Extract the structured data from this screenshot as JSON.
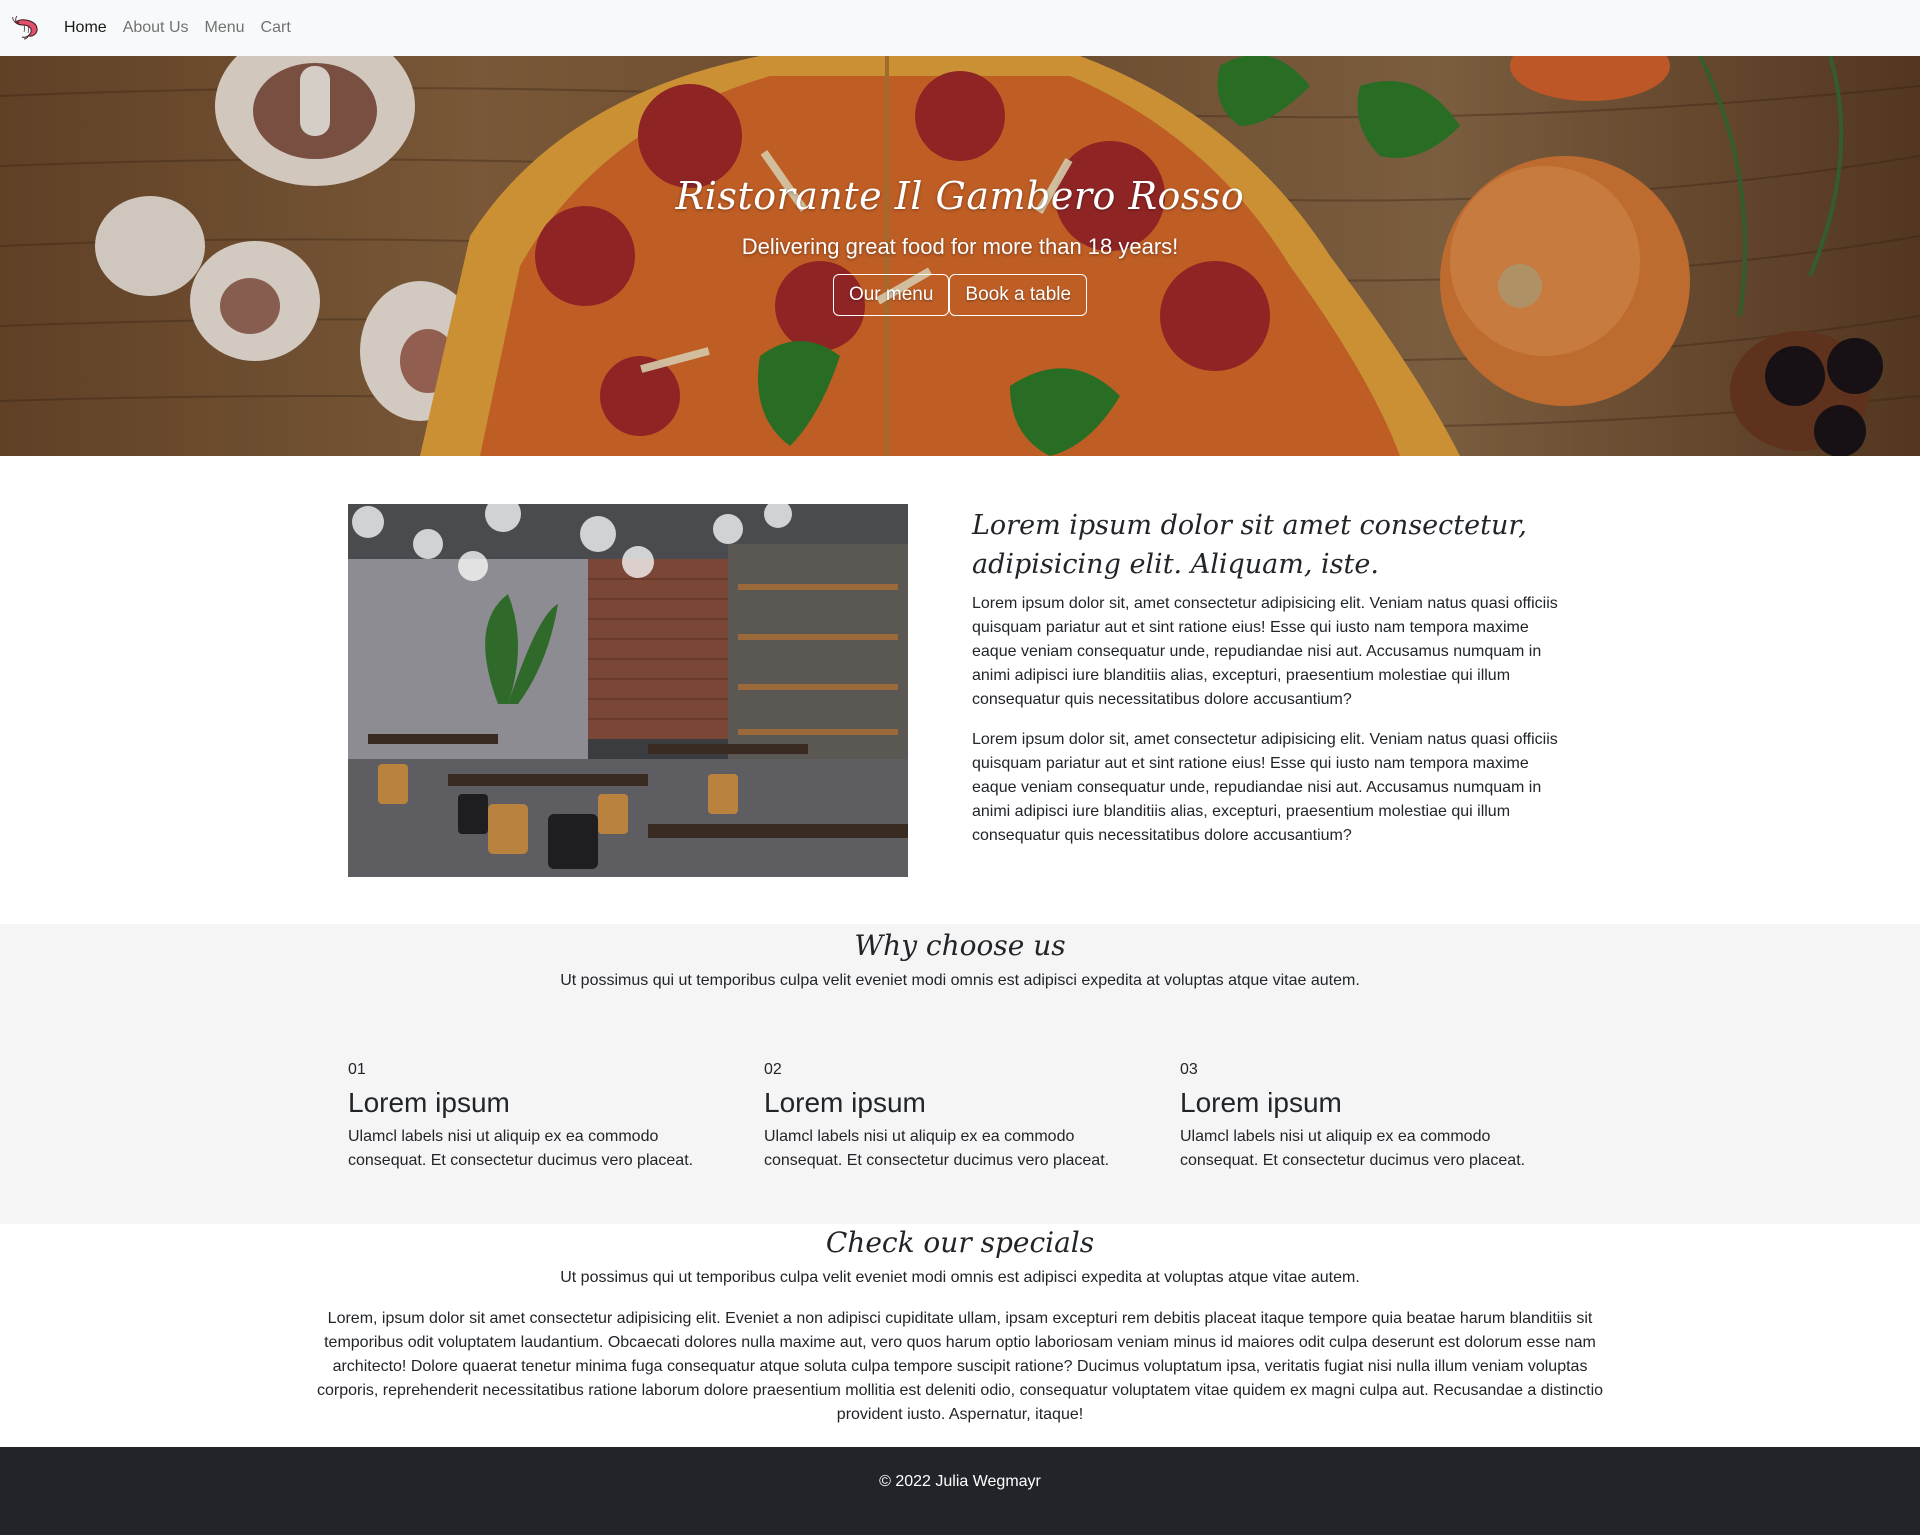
{
  "nav": {
    "brand_icon": "shrimp-logo-icon",
    "links": [
      {
        "label": "Home",
        "active": true
      },
      {
        "label": "About Us",
        "active": false
      },
      {
        "label": "Menu",
        "active": false
      },
      {
        "label": "Cart",
        "active": false
      }
    ]
  },
  "hero": {
    "title": "Ristorante Il Gambero Rosso",
    "subtitle": "Delivering great food for more than 18 years!",
    "buttons": {
      "menu": "Our menu",
      "book": "Book a table"
    }
  },
  "about": {
    "heading": "Lorem ipsum dolor sit amet consectetur, adipisicing elit. Aliquam, iste.",
    "paragraphs": [
      "Lorem ipsum dolor sit, amet consectetur adipisicing elit. Veniam natus quasi officiis quisquam pariatur aut et sint ratione eius! Esse qui iusto nam tempora maxime eaque veniam consequatur unde, repudiandae nisi aut. Accusamus numquam in animi adipisci iure blanditiis alias, excepturi, praesentium molestiae qui illum consequatur quis necessitatibus dolore accusantium?",
      "Lorem ipsum dolor sit, amet consectetur adipisicing elit. Veniam natus quasi officiis quisquam pariatur aut et sint ratione eius! Esse qui iusto nam tempora maxime eaque veniam consequatur unde, repudiandae nisi aut. Accusamus numquam in animi adipisci iure blanditiis alias, excepturi, praesentium molestiae qui illum consequatur quis necessitatibus dolore accusantium?"
    ]
  },
  "why": {
    "title": "Why choose us",
    "subtitle": "Ut possimus qui ut temporibus culpa velit eveniet modi omnis est adipisci expedita at voluptas atque vitae autem.",
    "features": [
      {
        "number": "01",
        "title": "Lorem ipsum",
        "desc": "Ulamcl labels nisi ut aliquip ex ea commodo consequat. Et consectetur ducimus vero placeat."
      },
      {
        "number": "02",
        "title": "Lorem ipsum",
        "desc": "Ulamcl labels nisi ut aliquip ex ea commodo consequat. Et consectetur ducimus vero placeat."
      },
      {
        "number": "03",
        "title": "Lorem ipsum",
        "desc": "Ulamcl labels nisi ut aliquip ex ea commodo consequat. Et consectetur ducimus vero placeat."
      }
    ]
  },
  "specials": {
    "title": "Check our specials",
    "subtitle": "Ut possimus qui ut temporibus culpa velit eveniet modi omnis est adipisci expedita at voluptas atque vitae autem.",
    "text": "Lorem, ipsum dolor sit amet consectetur adipisicing elit. Eveniet a non adipisci cupiditate ullam, ipsam excepturi rem debitis placeat itaque tempore quia beatae harum blanditiis sit temporibus odit voluptatem laudantium. Obcaecati dolores nulla maxime aut, vero quos harum optio laboriosam veniam minus id maiores odit culpa deserunt est dolorum esse nam architecto! Dolore quaerat tenetur minima fuga consequatur atque soluta culpa tempore suscipit ratione? Ducimus voluptatum ipsa, veritatis fugiat nisi nulla illum veniam voluptas corporis, reprehenderit necessitatibus ratione laborum dolore praesentium mollitia est deleniti odio, consequatur voluptatem vitae quidem ex magni culpa aut. Recusandae a distinctio provident iusto. Aspernatur, itaque!"
  },
  "footer": {
    "copyright": "© 2022 Julia Wegmayr"
  },
  "colors": {
    "navbar_bg": "#f8f9fa",
    "section_gray": "#f5f5f5",
    "footer_bg": "#212529",
    "text": "#212529"
  }
}
